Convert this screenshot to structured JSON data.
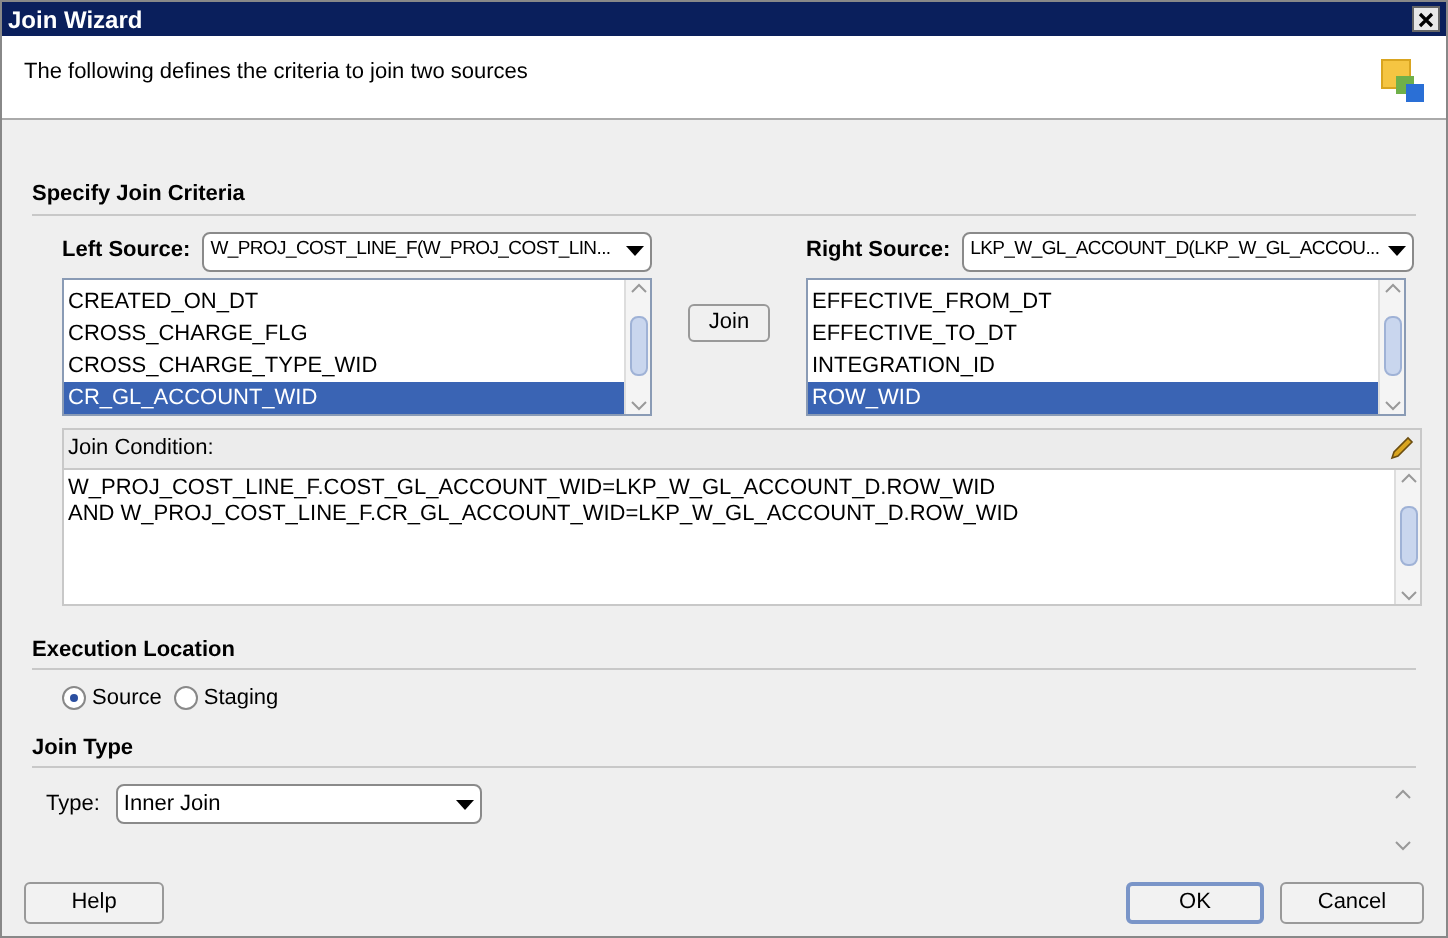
{
  "window": {
    "title": "Join Wizard"
  },
  "header": {
    "description": "The following defines the criteria to join two sources"
  },
  "join_criteria": {
    "heading": "Specify Join Criteria",
    "left_source": {
      "label": "Left Source:",
      "value": "W_PROJ_COST_LINE_F(W_PROJ_COST_LIN...",
      "columns": [
        {
          "label": "CREATED_ON_DT",
          "selected": false
        },
        {
          "label": "CROSS_CHARGE_FLG",
          "selected": false
        },
        {
          "label": "CROSS_CHARGE_TYPE_WID",
          "selected": false
        },
        {
          "label": "CR_GL_ACCOUNT_WID",
          "selected": true
        }
      ]
    },
    "join_button": "Join",
    "right_source": {
      "label": "Right Source:",
      "value": "LKP_W_GL_ACCOUNT_D(LKP_W_GL_ACCOU...",
      "columns": [
        {
          "label": "EFFECTIVE_FROM_DT",
          "selected": false
        },
        {
          "label": "EFFECTIVE_TO_DT",
          "selected": false
        },
        {
          "label": "INTEGRATION_ID",
          "selected": false
        },
        {
          "label": "ROW_WID",
          "selected": true
        }
      ]
    },
    "join_condition": {
      "label": "Join Condition:",
      "lines": [
        "W_PROJ_COST_LINE_F.COST_GL_ACCOUNT_WID=LKP_W_GL_ACCOUNT_D.ROW_WID",
        "AND W_PROJ_COST_LINE_F.CR_GL_ACCOUNT_WID=LKP_W_GL_ACCOUNT_D.ROW_WID"
      ]
    }
  },
  "execution_location": {
    "heading": "Execution Location",
    "options": [
      {
        "label": "Source",
        "selected": true
      },
      {
        "label": "Staging",
        "selected": false
      }
    ]
  },
  "join_type": {
    "heading": "Join Type",
    "label": "Type:",
    "value": "Inner Join"
  },
  "buttons": {
    "help": "Help",
    "ok": "OK",
    "cancel": "Cancel"
  }
}
